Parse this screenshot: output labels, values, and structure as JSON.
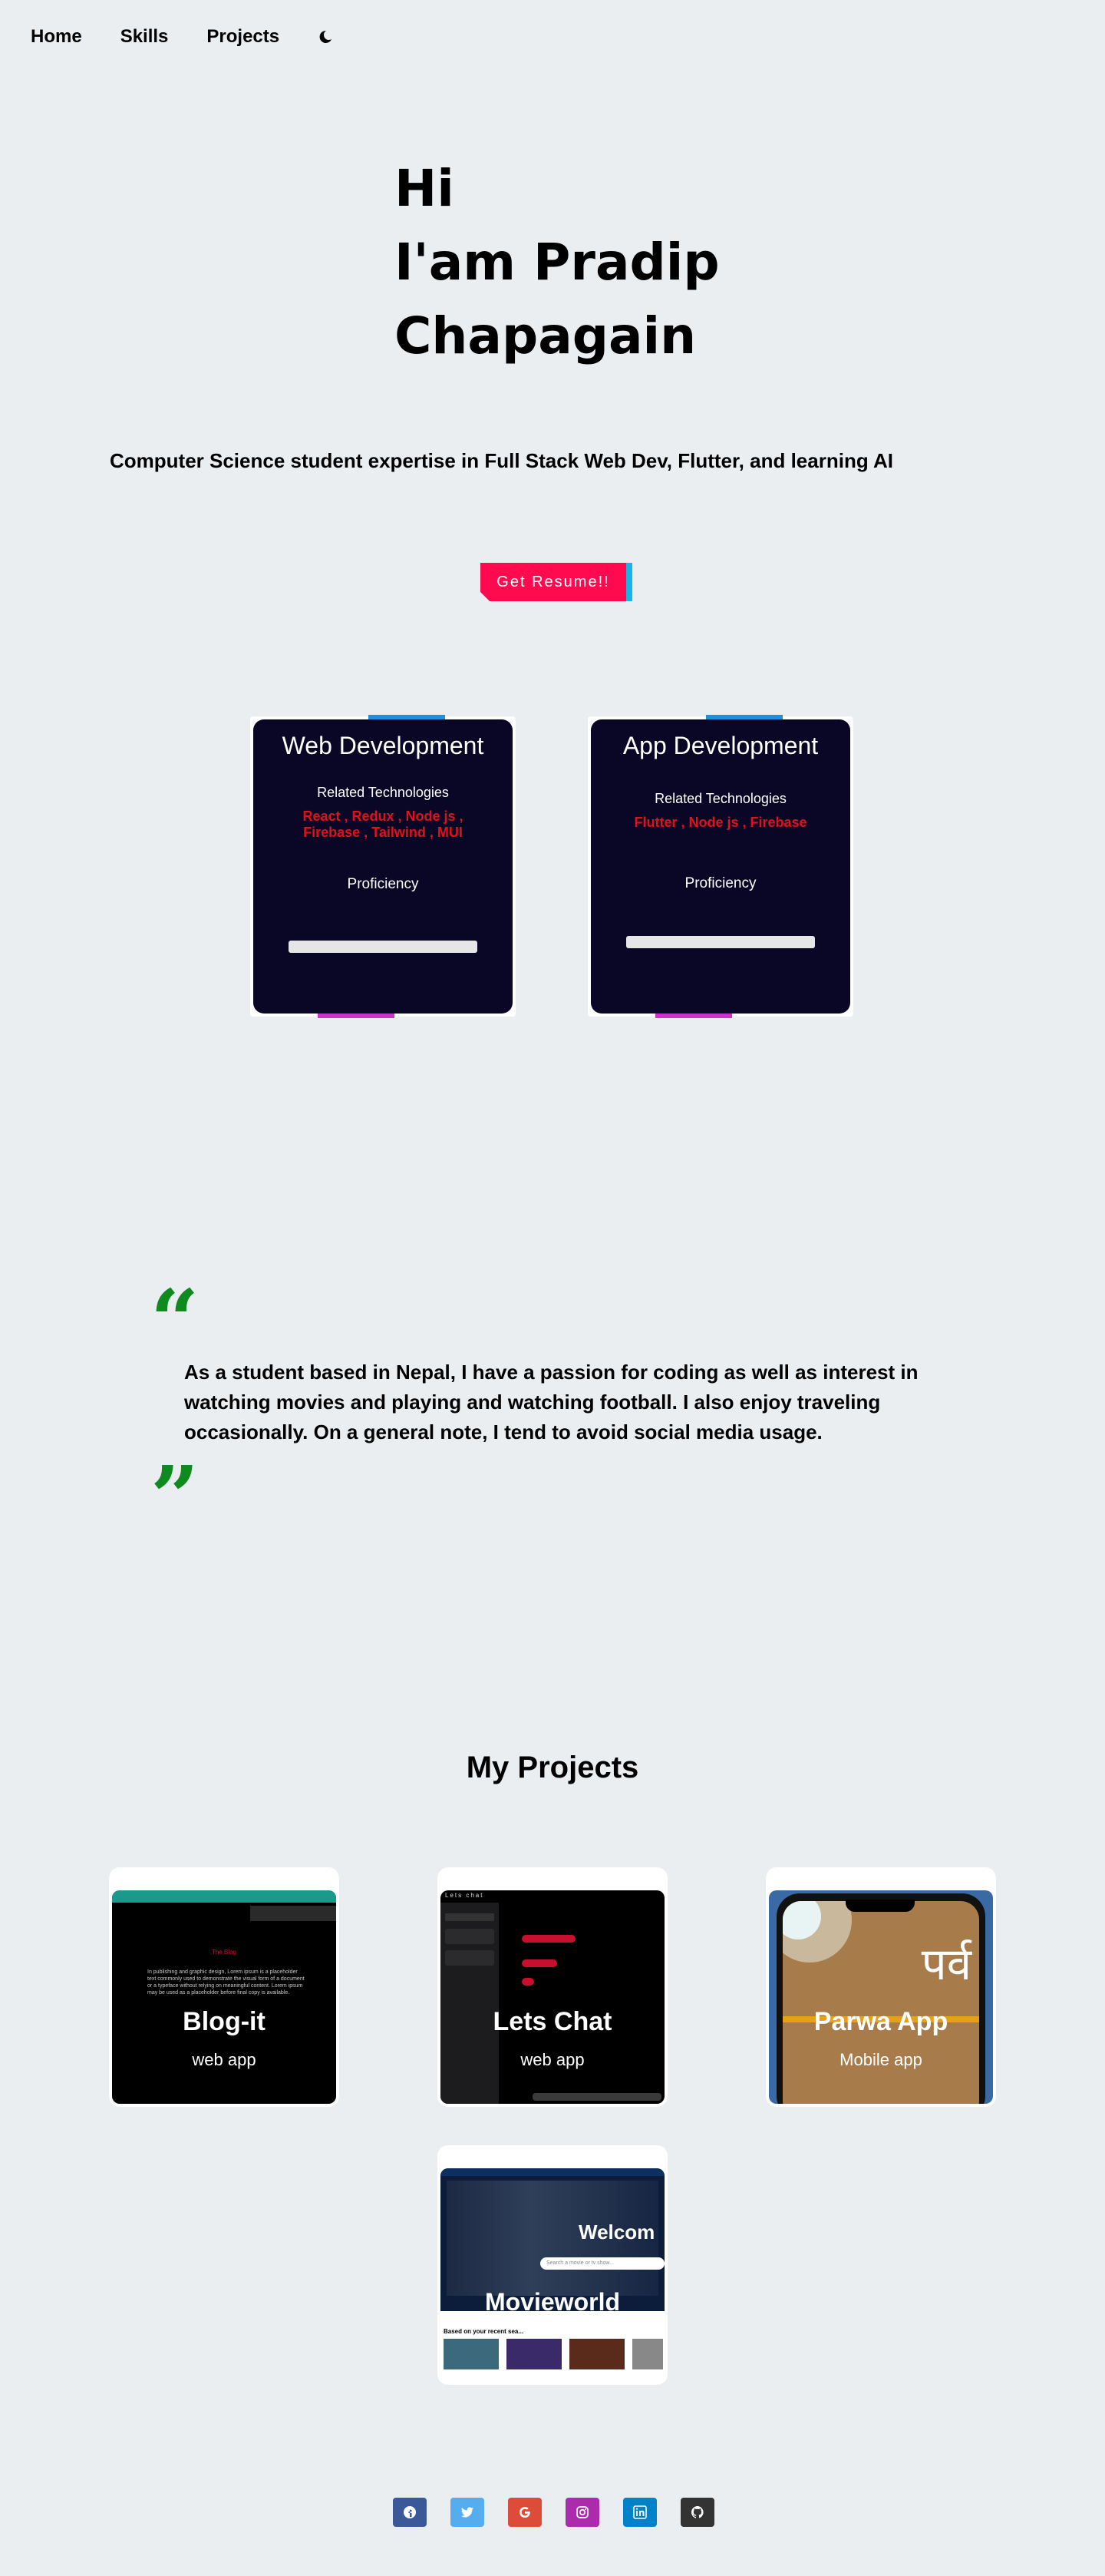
{
  "nav": {
    "items": [
      "Home",
      "Skills",
      "Projects"
    ],
    "theme_toggle": "moon-icon"
  },
  "hero": {
    "lines": [
      "Hi",
      "I'am Pradip",
      "Chapagain"
    ]
  },
  "tagline": "Computer Science student expertise in Full Stack Web Dev, Flutter, and learning AI",
  "resume": {
    "label": "Get Resume!!"
  },
  "skills": [
    {
      "title": "Web Development",
      "related_label": "Related Technologies",
      "tech_lines": [
        "React , Redux , Node js ,",
        "Firebase , Tailwind , MUI"
      ],
      "proficiency_label": "Proficiency"
    },
    {
      "title": "App Development",
      "related_label": "Related Technologies",
      "tech_lines": [
        "Flutter , Node js , Firebase"
      ],
      "proficiency_label": "Proficiency"
    }
  ],
  "about": {
    "text": "As a student based in Nepal, I have a passion for coding as well as interest in watching movies and playing and watching football. I also enjoy traveling occasionally. On a general note, I tend to avoid social media usage."
  },
  "projects": {
    "title": "My Projects",
    "items": [
      {
        "name": "Blog-it",
        "kind": "web app"
      },
      {
        "name": "Lets Chat",
        "kind": "web app"
      },
      {
        "name": "Parwa App",
        "kind": "Mobile app"
      },
      {
        "name": "Movieworld",
        "kind": ""
      }
    ],
    "blog_title": "The Blog",
    "blog_body": "In publishing and graphic design, Lorem ipsum is a placeholder text commonly used to demonstrate the visual form of a document or a typeface without relying on meaningful content. Lorem ipsum may be used as a placeholder before final copy is available.",
    "chat_brand": "Lets chat",
    "parwa_glyph": "पर्व",
    "movie_welcome": "Welcom",
    "movie_search": "Search a movie or tv show...",
    "movie_section": "Based on your recent sea..."
  },
  "social": [
    {
      "name": "facebook-icon",
      "color": "#3b5998"
    },
    {
      "name": "twitter-icon",
      "color": "#55acee"
    },
    {
      "name": "google-icon",
      "color": "#dd4b39"
    },
    {
      "name": "instagram-icon",
      "color": "#ac2bac"
    },
    {
      "name": "linkedin-icon",
      "color": "#0082ca"
    },
    {
      "name": "github-icon",
      "color": "#333333"
    }
  ]
}
